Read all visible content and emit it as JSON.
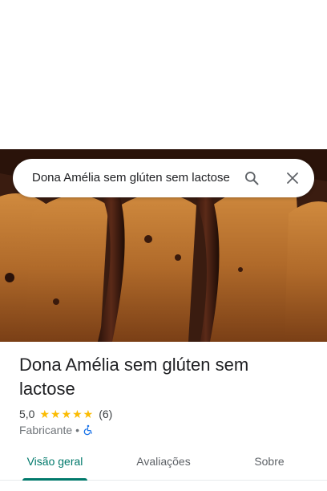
{
  "search": {
    "query": "Dona Amélia sem glúten sem lactose",
    "search_icon": "search-icon",
    "close_icon": "close-icon"
  },
  "place": {
    "name": "Dona Amélia sem glúten sem lactose",
    "rating": "5,0",
    "stars": "★★★★★",
    "review_count": "(6)",
    "category": "Fabricante",
    "separator": "•",
    "accessibility_icon": "wheelchair-icon"
  },
  "tabs": [
    {
      "label": "Visão geral",
      "active": true
    },
    {
      "label": "Avaliações",
      "active": false
    },
    {
      "label": "Sobre",
      "active": false
    }
  ],
  "colors": {
    "accent": "#00796b",
    "star": "#fbbc04",
    "accessibility_icon": "#1a73e8"
  }
}
